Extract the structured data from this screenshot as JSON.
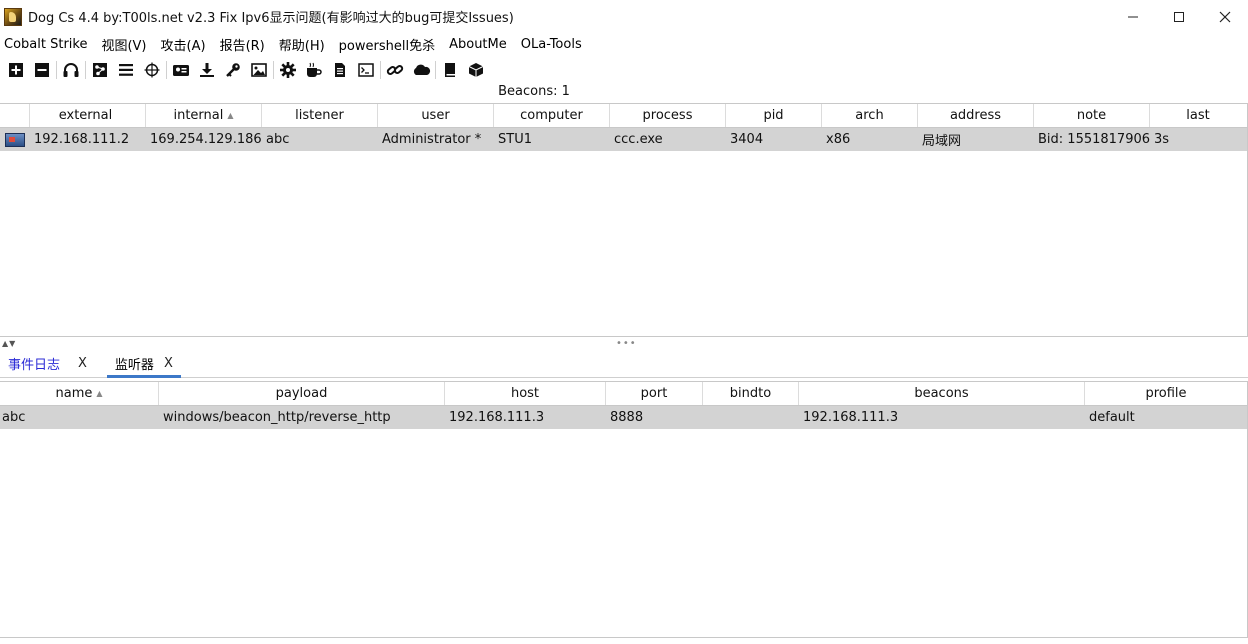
{
  "window": {
    "title": "Dog Cs 4.4 by:T00ls.net v2.3 Fix Ipv6显示问题(有影响过大的bug可提交Issues)",
    "controls": [
      "minimize-icon",
      "maximize-icon",
      "close-icon"
    ]
  },
  "menu": [
    "Cobalt Strike",
    "视图(V)",
    "攻击(A)",
    "报告(R)",
    "帮助(H)",
    "powershell免杀",
    "AboutMe",
    "OLa-Tools"
  ],
  "toolbar": {
    "icons": [
      "plus-icon",
      "minus-icon",
      "sep",
      "headphones-icon",
      "sep",
      "pivot-graph-icon",
      "list-icon",
      "target-icon",
      "sep",
      "id-card-icon",
      "download-icon",
      "key-icon",
      "image-icon",
      "sep",
      "gear-icon",
      "coffee-icon",
      "document-icon",
      "terminal-icon",
      "sep",
      "link-icon",
      "cloud-icon",
      "sep",
      "book-icon",
      "package-icon"
    ]
  },
  "beacons": {
    "count_label": "Beacons: 1",
    "columns": [
      {
        "label": "external",
        "sort": ""
      },
      {
        "label": "internal",
        "sort": "▲"
      },
      {
        "label": "listener",
        "sort": ""
      },
      {
        "label": "user",
        "sort": ""
      },
      {
        "label": "computer",
        "sort": ""
      },
      {
        "label": "process",
        "sort": ""
      },
      {
        "label": "pid",
        "sort": ""
      },
      {
        "label": "arch",
        "sort": ""
      },
      {
        "label": "address",
        "sort": ""
      },
      {
        "label": "note",
        "sort": ""
      },
      {
        "label": "last",
        "sort": ""
      }
    ],
    "rows": [
      [
        "192.168.111.2",
        "169.254.129.186",
        "abc",
        "Administrator *",
        "STU1",
        "ccc.exe",
        "3404",
        "x86",
        "局域网",
        "Bid: 1551817906 ...",
        "3s"
      ]
    ]
  },
  "tabs": [
    {
      "label": "事件日志",
      "close": "X",
      "active": false
    },
    {
      "label": "监听器",
      "close": "X",
      "active": true
    }
  ],
  "listeners": {
    "columns": [
      {
        "label": "name",
        "sort": "▲"
      },
      {
        "label": "payload",
        "sort": ""
      },
      {
        "label": "host",
        "sort": ""
      },
      {
        "label": "port",
        "sort": ""
      },
      {
        "label": "bindto",
        "sort": ""
      },
      {
        "label": "beacons",
        "sort": ""
      },
      {
        "label": "profile",
        "sort": ""
      }
    ],
    "rows": [
      [
        "abc",
        "windows/beacon_http/reverse_http",
        "192.168.111.3",
        "8888",
        "",
        "192.168.111.3",
        "default"
      ]
    ]
  }
}
